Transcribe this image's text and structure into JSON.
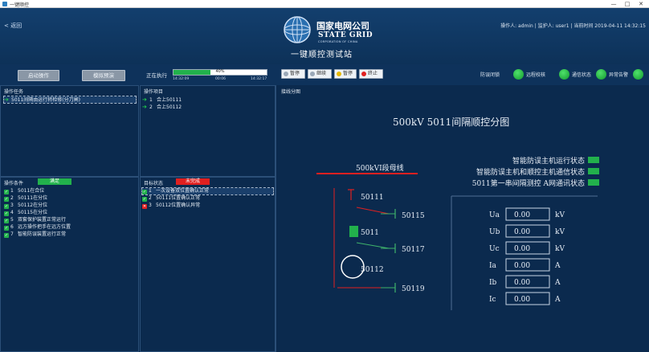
{
  "window": {
    "title": "一键顺控",
    "minimize": "—",
    "maximize": "□",
    "close": "✕"
  },
  "header": {
    "home_link": "< 返回",
    "logo_cn": "国家电网公司",
    "logo_en": "STATE GRID",
    "logo_corp": "CORPORATION OF CHINA",
    "station_name": "一键顺控测试站",
    "user_info": "操作人: admin | 监护人: user1 | 当前时间 2019-04-11 14:32:15"
  },
  "toolbar": {
    "btn_start": "启动操作",
    "btn_mock": "模拟预演",
    "exec_label": "正在执行",
    "progress_pct": "40%",
    "progress_value": 0.4,
    "time_start": "14:32:09",
    "time_mid": "00:06",
    "time_end": "14:32:17",
    "ctl_pause": "暂停",
    "ctl_resume": "继续",
    "ctl_suspend": "暂停",
    "ctl_stop": "终止",
    "indicators": [
      {
        "label": "防误闭锁",
        "color": "#22b14c"
      },
      {
        "label": "远程校核",
        "color": "#22b14c"
      },
      {
        "label": "通信状态",
        "color": "#22b14c"
      },
      {
        "label": "异常告警",
        "color": "#22b14c"
      }
    ]
  },
  "panels": {
    "op_task": {
      "title": "操作任务",
      "rows": [
        "5011间隔由运行转检修(分刀闸)"
      ]
    },
    "op_steps": {
      "title": "操作项目",
      "rows": [
        {
          "num": "1",
          "text": "合上50111"
        },
        {
          "num": "2",
          "text": "合上50112"
        }
      ]
    },
    "op_conditions": {
      "title": "操作条件",
      "badge": "满足",
      "badge_color": "#22b14c",
      "rows": [
        {
          "num": "1",
          "text": "5011在合位"
        },
        {
          "num": "2",
          "text": "50111在分位"
        },
        {
          "num": "3",
          "text": "50112在分位"
        },
        {
          "num": "4",
          "text": "50115在分位"
        },
        {
          "num": "5",
          "text": "双套保护装置正常运行"
        },
        {
          "num": "6",
          "text": "远方操作把手在远方位置"
        },
        {
          "num": "7",
          "text": "智能防误装置运行正常"
        }
      ]
    },
    "target_state": {
      "title": "目标状态",
      "badge": "未完成",
      "badge_color": "#e02020",
      "rows": [
        {
          "num": "1",
          "text": "一次设备双位置确认正常",
          "ok": true
        },
        {
          "num": "2",
          "text": "50111位置确认正常",
          "ok": true
        },
        {
          "num": "3",
          "text": "50112位置确认异常",
          "ok": false
        }
      ]
    }
  },
  "diagram": {
    "label": "接线分图",
    "title": "500kV 5011间隔顺控分图",
    "bus_label": "500kVI段母线",
    "devices": {
      "d50111": "50111",
      "d50115": "50115",
      "d5011": "5011",
      "d50117": "50117",
      "d50112": "50112",
      "d50119": "50119"
    },
    "status_lines": [
      "智能防误主机运行状态",
      "智能防误主机和顺控主机通信状态",
      "5011第一串间隔测控 A网通讯状态"
    ],
    "measurements": [
      {
        "name": "Ua",
        "value": "0.00",
        "unit": "kV"
      },
      {
        "name": "Ub",
        "value": "0.00",
        "unit": "kV"
      },
      {
        "name": "Uc",
        "value": "0.00",
        "unit": "kV"
      },
      {
        "name": "Ia",
        "value": "0.00",
        "unit": "A"
      },
      {
        "name": "Ib",
        "value": "0.00",
        "unit": "A"
      },
      {
        "name": "Ic",
        "value": "0.00",
        "unit": "A"
      }
    ],
    "colors": {
      "bus": "#e02020",
      "line": "#e02020",
      "breaker": "#22b14c",
      "status_ok": "#22b14c"
    }
  }
}
